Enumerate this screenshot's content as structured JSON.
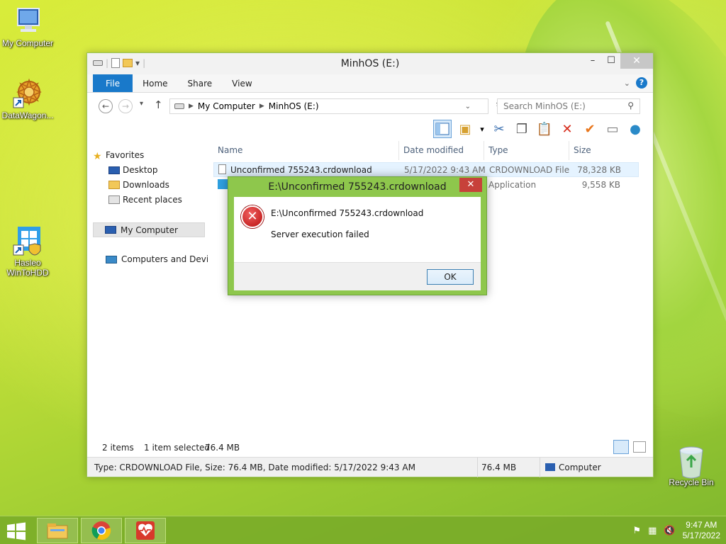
{
  "desktop": {
    "icons": [
      {
        "label": "My Computer"
      },
      {
        "label": "DataWagon..."
      },
      {
        "label": "Hasleo WinToHDD"
      },
      {
        "label": "Recycle Bin"
      }
    ]
  },
  "window": {
    "title": "MinhOS (E:)",
    "controls": {
      "minimize": "–",
      "maximize": "☐",
      "close": "✕"
    },
    "tabs": [
      "File",
      "Home",
      "Share",
      "View"
    ],
    "address": {
      "segments": [
        "My Computer",
        "MinhOS (E:)"
      ]
    },
    "search": {
      "placeholder": "Search MinhOS (E:)"
    },
    "nav_pane": {
      "favorites": "Favorites",
      "desktop": "Desktop",
      "downloads": "Downloads",
      "recent": "Recent places",
      "my_computer": "My Computer",
      "network": "Computers and Devices"
    },
    "columns": [
      "Name",
      "Date modified",
      "Type",
      "Size"
    ],
    "files": [
      {
        "name": "Unconfirmed 755243.crdownload",
        "date": "5/17/2022 9:43 AM",
        "type": "CRDOWNLOAD File",
        "size": "78,328 KB"
      },
      {
        "name": "",
        "date": "",
        "type": "Application",
        "size": "9,558 KB"
      }
    ],
    "status": {
      "items": "2 items",
      "selected": "1 item selected",
      "selected_size": "76.4 MB"
    },
    "details": {
      "text": "Type: CRDOWNLOAD File, Size: 76.4 MB, Date modified: 5/17/2022 9:43 AM",
      "size": "76.4 MB",
      "location": "Computer"
    }
  },
  "dialog": {
    "title": "E:\\Unconfirmed 755243.crdownload",
    "path": "E:\\Unconfirmed 755243.crdownload",
    "message": "Server execution failed",
    "ok": "OK",
    "close": "✕"
  },
  "taskbar": {
    "time": "9:47 AM",
    "date": "5/17/2022"
  },
  "colors": {
    "accent": "#1979ca",
    "dialog_frame": "#8ec74c",
    "error_red": "#c7413a"
  }
}
